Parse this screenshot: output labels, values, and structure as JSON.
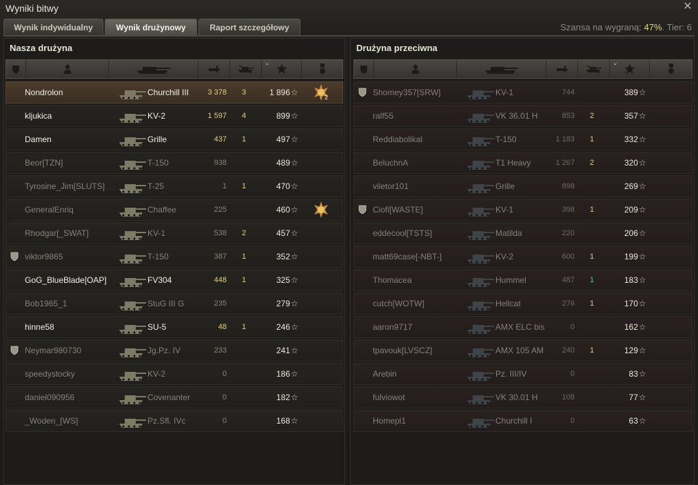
{
  "window": {
    "title": "Wyniki bitwy",
    "close_label": "✕"
  },
  "tabs": [
    {
      "label": "Wynik indywidualny",
      "active": false
    },
    {
      "label": "Wynik drużynowy",
      "active": true
    },
    {
      "label": "Raport szczegółowy",
      "active": false
    }
  ],
  "win_chance": {
    "label": "Szansa na wygraną:",
    "value": "47%",
    "tier_label": "Tier: 6"
  },
  "columns": [
    "squad-icon",
    "player-icon",
    "tank-icon",
    "damage-icon",
    "kills-icon",
    "xp-star-icon",
    "medal-icon"
  ],
  "left": {
    "title": "Nasza drużyna",
    "rows": [
      {
        "name": "Nondrolon",
        "tank": "Churchill III",
        "damage": "3 378",
        "kills": "3",
        "xp": "1 896",
        "alive": true,
        "self": true,
        "squad": false,
        "medal": "medal-icon",
        "medal_count": "2"
      },
      {
        "name": "kljukica",
        "tank": "KV-2",
        "damage": "1 597",
        "kills": "4",
        "xp": "899",
        "alive": true,
        "squad": false
      },
      {
        "name": "Damen",
        "tank": "Grille",
        "damage": "437",
        "kills": "1",
        "xp": "497",
        "alive": true,
        "squad": false
      },
      {
        "name": "Beor[TZN]",
        "tank": "T-150",
        "damage": "938",
        "kills": "",
        "xp": "489",
        "alive": false,
        "squad": false
      },
      {
        "name": "Tyrosine_Jim[SLUTS]",
        "tank": "T-25",
        "damage": "1",
        "kills": "1",
        "xp": "470",
        "alive": false,
        "squad": false
      },
      {
        "name": "GeneralEnriq",
        "tank": "Chaffee",
        "damage": "225",
        "kills": "",
        "xp": "460",
        "alive": false,
        "squad": false,
        "medal": "medal-icon"
      },
      {
        "name": "Rhodgar[_SWAT]",
        "tank": "KV-1",
        "damage": "538",
        "kills": "2",
        "xp": "457",
        "alive": false,
        "squad": false
      },
      {
        "name": "viktor9865",
        "tank": "T-150",
        "damage": "387",
        "kills": "1",
        "xp": "352",
        "alive": false,
        "squad": true
      },
      {
        "name": "GoG_BlueBlade[OAP]",
        "tank": "FV304",
        "damage": "448",
        "kills": "1",
        "xp": "325",
        "alive": true,
        "squad": false
      },
      {
        "name": "Bob1965_1",
        "tank": "StuG III G",
        "damage": "235",
        "kills": "",
        "xp": "279",
        "alive": false,
        "squad": false
      },
      {
        "name": "hinne58",
        "tank": "SU-5",
        "damage": "48",
        "kills": "1",
        "xp": "246",
        "alive": true,
        "squad": false
      },
      {
        "name": "Neymar980730",
        "tank": "Jg.Pz. IV",
        "damage": "233",
        "kills": "",
        "xp": "241",
        "alive": false,
        "squad": true
      },
      {
        "name": "speedystocky",
        "tank": "KV-2",
        "damage": "0",
        "kills": "",
        "xp": "186",
        "alive": false,
        "squad": false
      },
      {
        "name": "daniel090956",
        "tank": "Covenanter",
        "damage": "0",
        "kills": "",
        "xp": "182",
        "alive": false,
        "squad": false
      },
      {
        "name": "_Woden_[WS]",
        "tank": "Pz.Sfl. IVc",
        "damage": "0",
        "kills": "",
        "xp": "168",
        "alive": false,
        "squad": false
      }
    ]
  },
  "right": {
    "title": "Drużyna przeciwna",
    "rows": [
      {
        "name": "Shomey357[SRW]",
        "tank": "KV-1",
        "damage": "744",
        "kills": "",
        "xp": "389",
        "squad": true
      },
      {
        "name": "ralf55",
        "tank": "VK 36.01 H",
        "damage": "853",
        "kills": "2",
        "xp": "357",
        "squad": false
      },
      {
        "name": "Reddiabolikal",
        "tank": "T-150",
        "damage": "1 183",
        "kills": "1",
        "xp": "332",
        "squad": false
      },
      {
        "name": "BeluchnA",
        "tank": "T1 Heavy",
        "damage": "1 267",
        "kills": "2",
        "xp": "320",
        "squad": false
      },
      {
        "name": "viletor101",
        "tank": "Grille",
        "damage": "898",
        "kills": "",
        "xp": "269",
        "squad": false
      },
      {
        "name": "Ciofi[WASTE]",
        "tank": "KV-1",
        "damage": "398",
        "kills": "1",
        "xp": "209",
        "squad": true
      },
      {
        "name": "eddecool[TSTS]",
        "tank": "Matilda",
        "damage": "220",
        "kills": "",
        "xp": "206",
        "squad": false
      },
      {
        "name": "matt69case[-NBT-]",
        "tank": "KV-2",
        "damage": "600",
        "kills": "1",
        "xp": "199",
        "squad": false
      },
      {
        "name": "Thomacea",
        "tank": "Hummel",
        "damage": "487",
        "kills": "1",
        "xp": "183",
        "squad": false,
        "kills_cyan": true
      },
      {
        "name": "cutch[WOTW]",
        "tank": "Hellcat",
        "damage": "276",
        "kills": "1",
        "xp": "170",
        "squad": false
      },
      {
        "name": "aaron9717",
        "tank": "AMX ELC bis",
        "damage": "0",
        "kills": "",
        "xp": "162",
        "squad": false
      },
      {
        "name": "tpavouk[LVSCZ]",
        "tank": "AMX 105 AM",
        "damage": "240",
        "kills": "1",
        "xp": "129",
        "squad": false
      },
      {
        "name": "Arebin",
        "tank": "Pz. III/IV",
        "damage": "0",
        "kills": "",
        "xp": "83",
        "squad": false
      },
      {
        "name": "fulviowot",
        "tank": "VK 30.01 H",
        "damage": "108",
        "kills": "",
        "xp": "77",
        "squad": false
      },
      {
        "name": "Homepl1",
        "tank": "Churchill I",
        "damage": "0",
        "kills": "",
        "xp": "63",
        "squad": false
      }
    ]
  },
  "colors": {
    "accent": "#e6d66a",
    "self_row": "#4b3b2d",
    "enemy_row": "#2a2221",
    "cyan_kill": "#4fc4d8"
  }
}
